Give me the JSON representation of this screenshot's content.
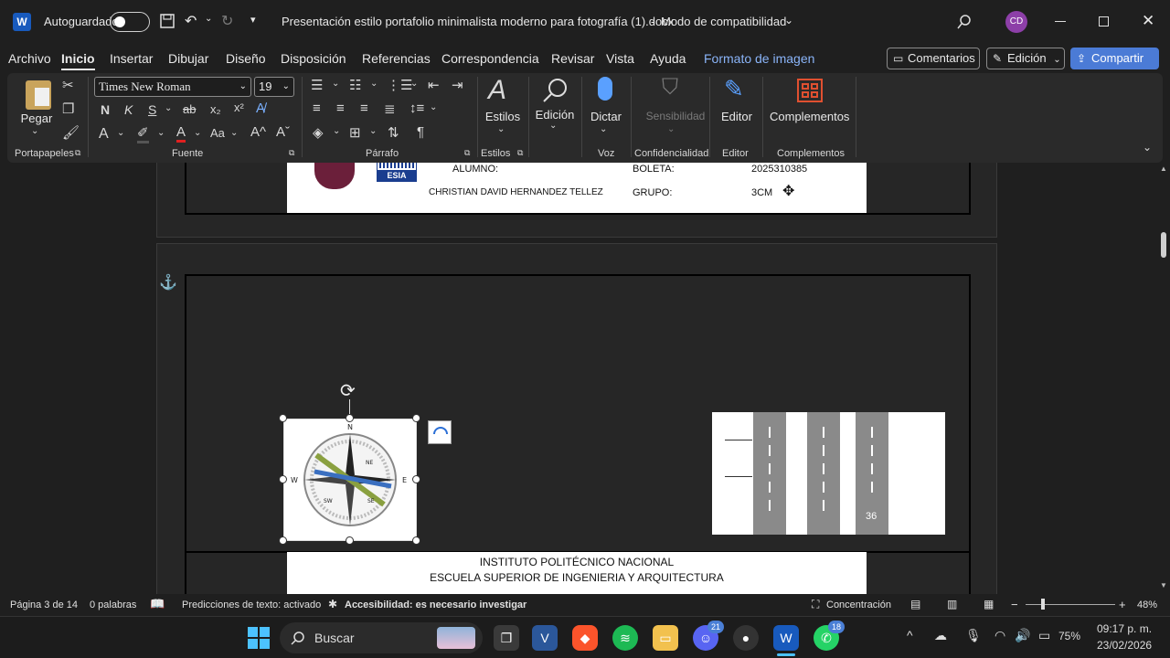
{
  "titlebar": {
    "autosave_label": "Autoguardado",
    "doc_title": "Presentación estilo portafolio minimalista moderno para fotografía (1).docx",
    "separator": "-",
    "compat_mode": "Modo de compatibilidad",
    "user_initials": "CD"
  },
  "menu": {
    "items": [
      "Archivo",
      "Inicio",
      "Insertar",
      "Dibujar",
      "Diseño",
      "Disposición",
      "Referencias",
      "Correspondencia",
      "Revisar",
      "Vista",
      "Ayuda",
      "Formato de imagen"
    ],
    "comments_label": "Comentarios",
    "edit_label": "Edición",
    "share_label": "Compartir"
  },
  "ribbon": {
    "paste_label": "Pegar",
    "font_name": "Times New Roman",
    "font_size": "19",
    "styles_label": "Estilos",
    "editing_label": "Edición",
    "dictate_label": "Dictar",
    "sensitivity_label": "Sensibilidad",
    "editor_label": "Editor",
    "addins_label": "Complementos",
    "groups": {
      "clipboard": "Portapapeles",
      "font": "Fuente",
      "paragraph": "Párrafo",
      "styles": "Estilos",
      "voice": "Voz",
      "confidentiality": "Confidencialidad",
      "editor": "Editor",
      "addins": "Complementos"
    }
  },
  "document": {
    "logo_text": "ESIA",
    "student_label": "ALUMNO:",
    "student_name": "CHRISTIAN DAVID HERNANDEZ TELLEZ",
    "boleta_label": "BOLETA:",
    "boleta_value": "2025310385",
    "group_label": "GRUPO:",
    "group_value": "3CM",
    "road_number": "36",
    "institute_line1": "INSTITUTO POLITÉCNICO NACIONAL",
    "institute_line2": "ESCUELA SUPERIOR DE INGENIERIA Y ARQUITECTURA",
    "compass_letters": [
      "N",
      "E",
      "W",
      "NE",
      "SW",
      "SE"
    ]
  },
  "status": {
    "page": "Página 3 de 14",
    "words": "0 palabras",
    "predictions": "Predicciones de texto: activado",
    "accessibility": "Accesibilidad: es necesario investigar",
    "focus": "Concentración",
    "zoom": "48%"
  },
  "taskbar": {
    "search_placeholder": "Buscar",
    "battery": "75%",
    "time": "09:17 p. m.",
    "date": "23/02/2026",
    "discord_badge": "21",
    "whatsapp_badge": "18"
  }
}
